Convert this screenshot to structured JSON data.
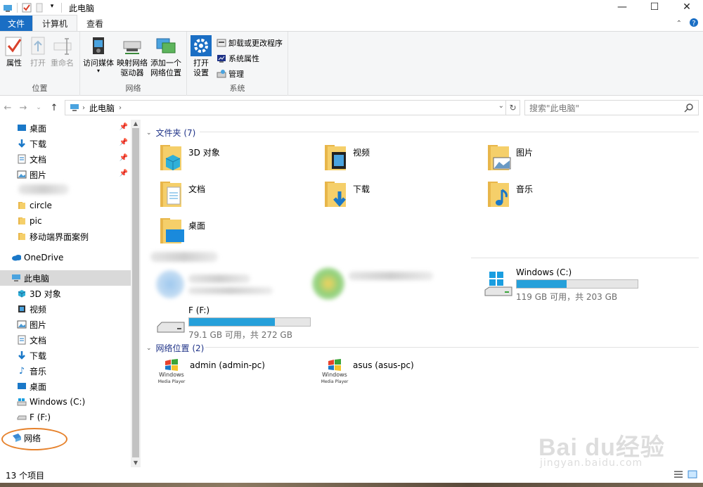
{
  "window": {
    "title": "此电脑"
  },
  "tabs": [
    {
      "label": "文件"
    },
    {
      "label": "计算机"
    },
    {
      "label": "查看"
    }
  ],
  "ribbon": {
    "location_group": {
      "label": "位置",
      "properties": "属性",
      "open": "打开",
      "rename": "重命名"
    },
    "network_group": {
      "label": "网络",
      "access_media": "访问媒体",
      "map_drive_l1": "映射网络",
      "map_drive_l2": "驱动器",
      "add_location_l1": "添加一个",
      "add_location_l2": "网络位置"
    },
    "system_group": {
      "label": "系统",
      "open_settings_l1": "打开",
      "open_settings_l2": "设置",
      "uninstall": "卸载或更改程序",
      "system_properties": "系统属性",
      "manage": "管理"
    }
  },
  "address": {
    "crumb": "此电脑"
  },
  "search": {
    "placeholder": "搜索\"此电脑\""
  },
  "nav": {
    "quick": [
      {
        "label": "桌面",
        "icon": "desktop-icon"
      },
      {
        "label": "下载",
        "icon": "download-icon"
      },
      {
        "label": "文档",
        "icon": "documents-icon"
      },
      {
        "label": "图片",
        "icon": "pictures-icon"
      }
    ],
    "folders": [
      {
        "label": "circle"
      },
      {
        "label": "pic"
      },
      {
        "label": "移动端界面案例"
      }
    ],
    "onedrive": "OneDrive",
    "this_pc": "此电脑",
    "pc_items": [
      {
        "label": "3D 对象"
      },
      {
        "label": "视频"
      },
      {
        "label": "图片"
      },
      {
        "label": "文档"
      },
      {
        "label": "下载"
      },
      {
        "label": "音乐"
      },
      {
        "label": "桌面"
      },
      {
        "label": "Windows (C:)"
      },
      {
        "label": "F (F:)"
      }
    ],
    "network": "网络"
  },
  "content": {
    "folders_header": "文件夹 (7)",
    "folders": [
      {
        "label": "3D 对象"
      },
      {
        "label": "视频"
      },
      {
        "label": "图片"
      },
      {
        "label": "文档"
      },
      {
        "label": "下载"
      },
      {
        "label": "音乐"
      },
      {
        "label": "桌面"
      }
    ],
    "drives": [
      {
        "label": "Windows (C:)",
        "info": "119 GB 可用，共 203 GB",
        "used_fraction": 0.41
      },
      {
        "label": "F (F:)",
        "info": "79.1 GB 可用，共 272 GB",
        "used_fraction": 0.71
      }
    ],
    "network_header": "网络位置 (2)",
    "network_locations": [
      {
        "label": "admin (admin-pc)",
        "logo_l1": "Windows",
        "logo_l2": "Media Player"
      },
      {
        "label": "asus (asus-pc)",
        "logo_l1": "Windows",
        "logo_l2": "Media Player"
      }
    ]
  },
  "status": {
    "text": "13 个项目"
  },
  "watermark": {
    "brand": "Bai du经验",
    "url": "jingyan.baidu.com"
  },
  "colors": {
    "accent": "#1a6ec4",
    "drive_fill": "#26a0da",
    "section_header": "#1e3287",
    "highlight_ring": "#e6812b"
  }
}
